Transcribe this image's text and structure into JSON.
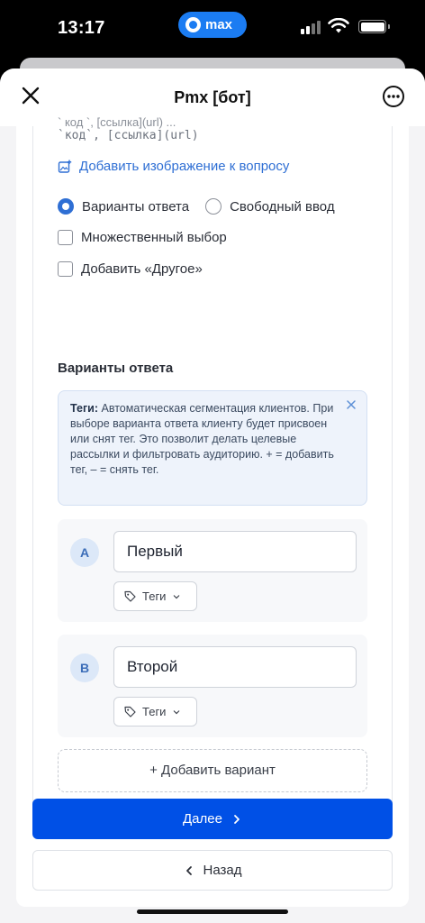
{
  "status_bar": {
    "time": "13:17",
    "app_pill": "max"
  },
  "header": {
    "title": "Pmx [бот]"
  },
  "editor": {
    "format_hint_cut": "` код `, [ссылка](url) ...",
    "format_hint": "`код`, [ссылка](url)",
    "add_image_label": "Добавить изображение к вопросу",
    "answer_type": {
      "options_label": "Варианты ответа",
      "free_input_label": "Свободный ввод",
      "selected": "Варианты ответа"
    },
    "multiple_choice_label": "Множественный выбор",
    "add_other_label": "Добавить «Другое»",
    "variants_title": "Варианты ответа",
    "tags_info": {
      "title": "Теги:",
      "text": "Автоматическая сегментация клиентов. При выборе варианта ответа клиенту будет присвоен или снят тег. Это позволит делать целевые рассылки и фильтровать аудиторию. + = добавить тег, – = снять тег."
    },
    "options": [
      {
        "letter": "A",
        "value": "Первый",
        "tags_label": "Теги"
      },
      {
        "letter": "B",
        "value": "Второй",
        "tags_label": "Теги"
      }
    ],
    "add_variant_label": "+ Добавить вариант"
  },
  "footer": {
    "next_label": "Далее",
    "back_label": "Назад"
  },
  "colors": {
    "accent": "#0050e6",
    "link": "#2f6fd4",
    "info_bg": "#eef3fb"
  }
}
